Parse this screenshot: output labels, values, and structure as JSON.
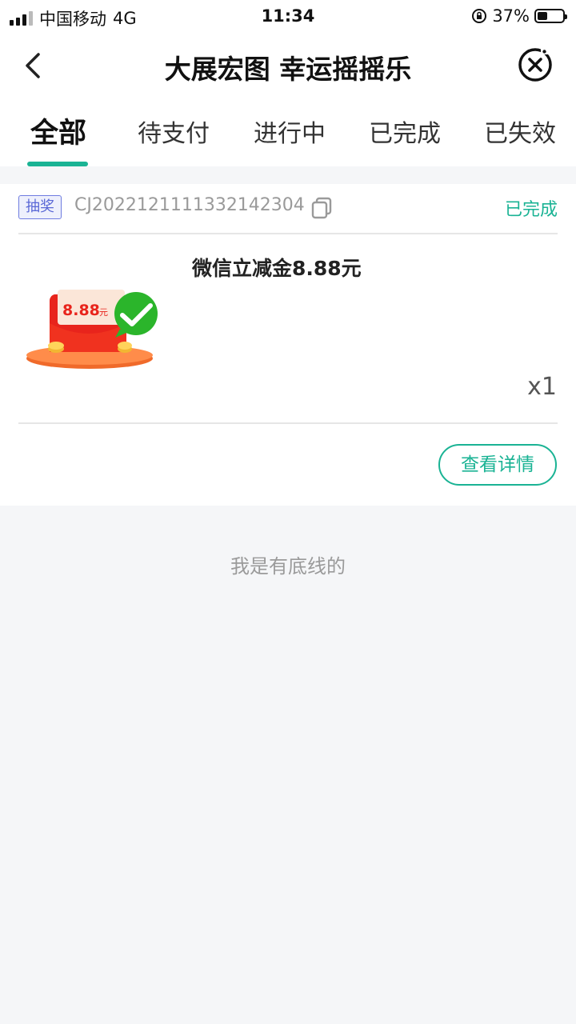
{
  "status_bar": {
    "carrier": "中国移动",
    "network": "4G",
    "time": "11:34",
    "battery": "37%"
  },
  "navbar": {
    "title": "大展宏图 幸运摇摇乐",
    "back_icon": "chevron-left-icon",
    "close_icon": "close-circle-icon"
  },
  "tabs": [
    {
      "label": "全部",
      "active": true
    },
    {
      "label": "待支付",
      "active": false
    },
    {
      "label": "进行中",
      "active": false
    },
    {
      "label": "已完成",
      "active": false
    },
    {
      "label": "已失效",
      "active": false
    }
  ],
  "order": {
    "tag": "抽奖",
    "order_no": "CJ2022121111332142304",
    "status": "已完成",
    "product_title": "微信立减金8.88元",
    "image_label": "8.88",
    "image_unit": "元",
    "quantity": "x1",
    "detail_button": "查看详情"
  },
  "footer_text": "我是有底线的",
  "colors": {
    "accent": "#1ab394",
    "tag": "#5a68d6",
    "background": "#f5f6f8"
  }
}
